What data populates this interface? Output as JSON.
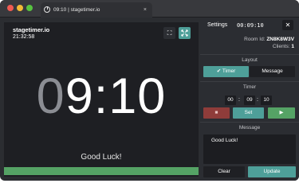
{
  "browser": {
    "tab_title": "09:10 | stagetimer.io",
    "tab_close": "×"
  },
  "stage": {
    "brand": "stagetimer.io",
    "clock": "21:32:58",
    "time_dim_part": "0",
    "time_main_part": "9:10",
    "message": "Good Luck!",
    "progress_fraction": 1.0,
    "fullscreen_icon": "expand-icon",
    "flip_icon": "flip-icon"
  },
  "settings": {
    "title": "Settings",
    "timer_readout": "00:09:10",
    "close_label": "✕",
    "room_label": "Room Id: ",
    "room_value": "ZN8K8W3V",
    "clients_label": "Clients: ",
    "clients_value": "1",
    "layout_label": "Layout",
    "layout_options": [
      "Timer",
      "Message"
    ],
    "layout_selected": "Timer",
    "layout_check": "✔",
    "timer_label": "Timer",
    "timer_hours": "00",
    "timer_minutes": "09",
    "timer_seconds": "10",
    "colon": ":",
    "stop_label": "■",
    "set_label": "Set",
    "play_label": "▶",
    "message_label": "Message",
    "message_value": "Good Luck!",
    "clear_label": "Clear",
    "update_label": "Update"
  },
  "colors": {
    "accent_teal": "#4e9f99",
    "accent_green": "#55a365",
    "stop_red": "#8f3c3a",
    "stage_bg": "#1e1f23",
    "panel_bg": "#2b2d32"
  }
}
